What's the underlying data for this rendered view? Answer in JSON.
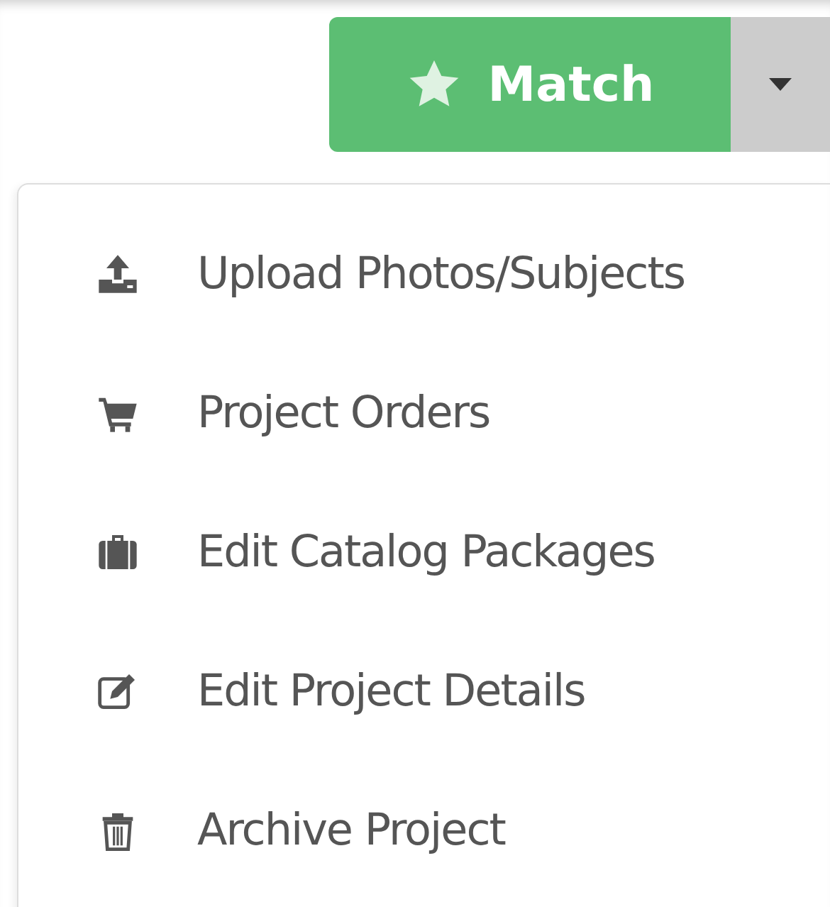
{
  "match_button": {
    "label": "Match"
  },
  "menu": {
    "items": [
      {
        "label": "Upload Photos/Subjects"
      },
      {
        "label": "Project Orders"
      },
      {
        "label": "Edit Catalog Packages"
      },
      {
        "label": "Edit Project Details"
      },
      {
        "label": "Archive Project"
      }
    ]
  }
}
